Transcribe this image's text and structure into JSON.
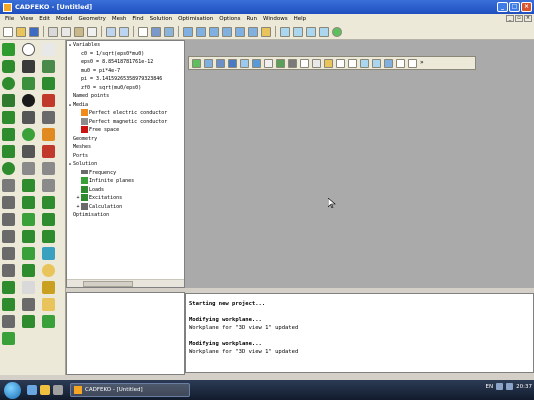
{
  "window": {
    "title": "CADFEKO - [Untitled]"
  },
  "menu": [
    "File",
    "View",
    "Edit",
    "Model",
    "Geometry",
    "Mesh",
    "Find",
    "Solution",
    "Optimisation",
    "Options",
    "Run",
    "Windows",
    "Help"
  ],
  "tree": {
    "variables_label": "Variables",
    "variables": [
      "c0 = 1/sqrt(eps0*mu0)",
      "eps0 = 8.85418781761e-12",
      "mu0 = pi*4e-7",
      "pi = 3.14159265358979323846",
      "zf0 = sqrt(mu0/eps0)"
    ],
    "named_points": "Named points",
    "media": "Media",
    "media_items": [
      {
        "label": "Perfect electric conductor",
        "color": "#f08a1a"
      },
      {
        "label": "Perfect magnetic conductor",
        "color": "#8c8c8c"
      },
      {
        "label": "Free space",
        "color": "#cc1111"
      }
    ],
    "geometry": "Geometry",
    "meshes": "Meshes",
    "ports": "Ports",
    "solution": "Solution",
    "solution_items": [
      "Frequency",
      "Infinite planes",
      "Loads",
      "Excitations",
      "Calculation"
    ],
    "optimisation": "Optimisation"
  },
  "output": {
    "lines": [
      {
        "text": "Starting new project...",
        "bold": true
      },
      {
        "text": "",
        "bold": false
      },
      {
        "text": "Modifying workplane...",
        "bold": true
      },
      {
        "text": "Workplane for \"3D view 1\" updated",
        "bold": false
      },
      {
        "text": "",
        "bold": false
      },
      {
        "text": "Modifying workplane...",
        "bold": true
      },
      {
        "text": "Workplane for \"3D view 1\" updated",
        "bold": false
      }
    ]
  },
  "taskbar": {
    "button": "CADFEKO - [Untitled]",
    "clock": "20:37",
    "lang": "EN"
  },
  "colors": {
    "title": "#2456c9",
    "workspace": "#aaaaaa",
    "panel": "#ece9d8"
  }
}
